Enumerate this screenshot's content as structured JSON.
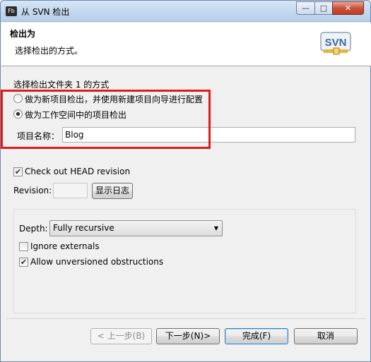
{
  "window": {
    "app_icon": "Fb",
    "title": "从 SVN 检出",
    "controls": {
      "minimize": "—",
      "maximize": "□",
      "close": "✕"
    }
  },
  "banner": {
    "title": "检出为",
    "description": "选择检出的方式。",
    "logo": "SVN"
  },
  "checkout": {
    "group_label": "选择检出文件夹 1 的方式",
    "option_new_project": "做为新项目检出，并使用新建项目向导进行配置",
    "option_workspace_project": "做为工作空间中的项目检出",
    "selected_option": "option_workspace_project",
    "project_name_label": "项目名称：",
    "project_name_value": "Blog"
  },
  "revision": {
    "head_checkbox_label": "Check out HEAD revision",
    "head_checked": true,
    "revision_label": "Revision:",
    "revision_value": "",
    "show_log_button": "显示日志"
  },
  "options": {
    "depth_label": "Depth:",
    "depth_value": "Fully recursive",
    "ignore_externals_label": "Ignore externals",
    "ignore_externals_checked": false,
    "allow_unversioned_label": "Allow unversioned obstructions",
    "allow_unversioned_checked": true
  },
  "footer": {
    "back_button": "< 上一步(B)",
    "next_button": "下一步(N)>",
    "finish_button": "完成(F)",
    "cancel_button": "取消"
  },
  "colors": {
    "highlight": "#e01b1b",
    "titlebar": "#c2d6ee",
    "banner": "#ffffff",
    "dialog_bg": "#f0f0f0"
  }
}
